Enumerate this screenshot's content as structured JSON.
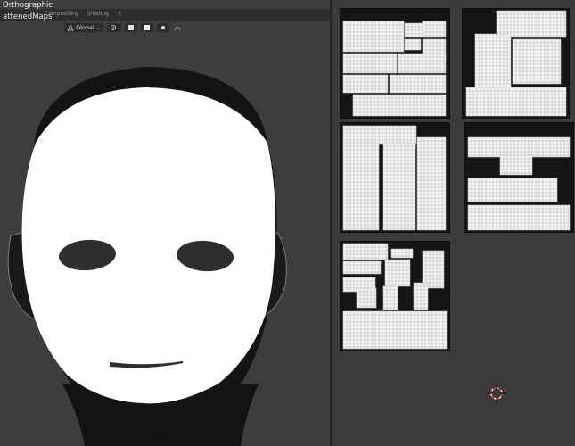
{
  "viewport": {
    "label_line1": "Orthographic",
    "label_line2": "attenedMaps",
    "tabs": [
      "Compositing",
      "Shading",
      "+"
    ],
    "toolbar": {
      "orientation": "Global",
      "chevron": "⌄"
    }
  },
  "colors": {
    "viewport_bg": "#3d3d3d",
    "mask_white": "#ffffff",
    "head_dark": "#141414",
    "uv_bg": "#151515",
    "cursor_red": "#e23b3b"
  },
  "icons": {
    "transform_pivot": "pivot-icon",
    "snap": "snap-icon",
    "proportional": "proportional-icon",
    "cursor": "3d-cursor-icon"
  },
  "uv_maps": [
    "uv-map-1",
    "uv-map-2",
    "uv-map-3",
    "uv-map-4",
    "uv-map-5"
  ]
}
